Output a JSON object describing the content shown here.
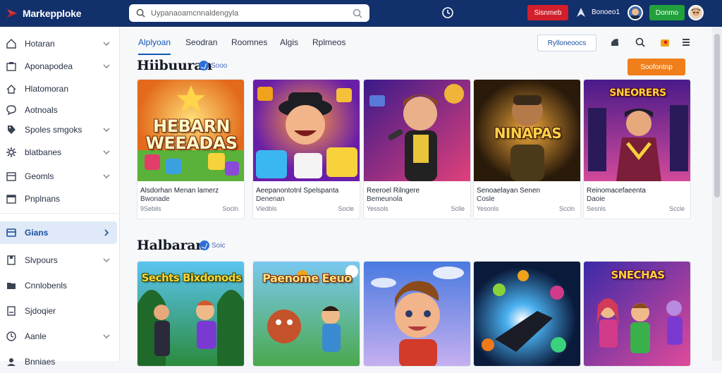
{
  "app": {
    "name": "Markepploke"
  },
  "topbar": {
    "search_placeholder": "Uypanaoamcnnaldengyla",
    "red_button": "Sisnmeb",
    "user_name": "Bonoeo1",
    "green_button": "Donmo"
  },
  "sidebar": {
    "items": [
      {
        "label": "Hotaran",
        "icon": "home-icon",
        "chevron": true
      },
      {
        "label": "Aponapodea",
        "icon": "box-icon",
        "chevron": true
      },
      {
        "label": "Hlatomoran",
        "icon": "house-outline-icon",
        "chevron": false
      },
      {
        "label": "Aotnoals",
        "icon": "chat-icon",
        "chevron": false
      },
      {
        "label": "Spoles smgoks",
        "icon": "tag-icon",
        "chevron": true
      },
      {
        "label": "blatbanes",
        "icon": "gear-icon",
        "chevron": true
      },
      {
        "label": "Geomls",
        "icon": "calendar-icon",
        "chevron": true
      },
      {
        "label": "Pnplnans",
        "icon": "window-icon",
        "chevron": false
      },
      {
        "label": "Gians",
        "icon": "grid-icon",
        "chevron": true,
        "active": true
      },
      {
        "label": "Slvpours",
        "icon": "doc-icon",
        "chevron": true
      },
      {
        "label": "Cnnlobenls",
        "icon": "folder-icon",
        "chevron": false
      },
      {
        "label": "Sjdoqier",
        "icon": "list-icon",
        "chevron": false
      },
      {
        "label": "Aanle",
        "icon": "clock-icon",
        "chevron": true
      },
      {
        "label": "Bnniaes",
        "icon": "user-icon",
        "chevron": false
      }
    ]
  },
  "tabs": [
    {
      "label": "Alplyoan",
      "active": true
    },
    {
      "label": "Seodran",
      "active": false
    },
    {
      "label": "Roomnes",
      "active": false
    },
    {
      "label": "Algis",
      "active": false
    },
    {
      "label": "Rplmeos",
      "active": false
    }
  ],
  "toolbar": {
    "link_button": "Rylloneoocs"
  },
  "sections": [
    {
      "title": "Hiibuuran",
      "badge": "Sooo",
      "action_button": "Soofontnp",
      "cards": [
        {
          "title": "Alsdorhan Menan lamerz",
          "subtitle": "Bwonade",
          "meta_left": "9Sebils",
          "meta_right": "Socln",
          "thumb_text": "HEBARN WEEADAS"
        },
        {
          "title": "Aeepanontotnl Spelspanta",
          "subtitle": "Denenan",
          "meta_left": "Vledbls",
          "meta_right": "Socle",
          "thumb_text": ""
        },
        {
          "title": "Reeroel Rilngere",
          "subtitle": "Bemeunola",
          "meta_left": "Yessols",
          "meta_right": "Sclle",
          "thumb_text": ""
        },
        {
          "title": "Senoaelayan Senen",
          "subtitle": "Cosle",
          "meta_left": "Yesonls",
          "meta_right": "Sccln",
          "thumb_text": "NINAPAS"
        },
        {
          "title": "Reinomacefaeenta",
          "subtitle": "Daoie",
          "meta_left": "Sesnls",
          "meta_right": "Sccle",
          "thumb_text": "SNEORERS"
        }
      ]
    },
    {
      "title": "Halbaran",
      "badge": "Soic",
      "cards": [
        {
          "thumb_text": "Sechts Bixdonods"
        },
        {
          "thumb_text": "Paenome Eeuo"
        },
        {
          "thumb_text": ""
        },
        {
          "thumb_text": ""
        },
        {
          "thumb_text": "SNECHAS"
        }
      ]
    }
  ],
  "colors": {
    "topbar": "#12306b",
    "accent": "#1358b8",
    "red": "#d21f2b",
    "green": "#21a03c",
    "orange": "#f07e1a"
  }
}
